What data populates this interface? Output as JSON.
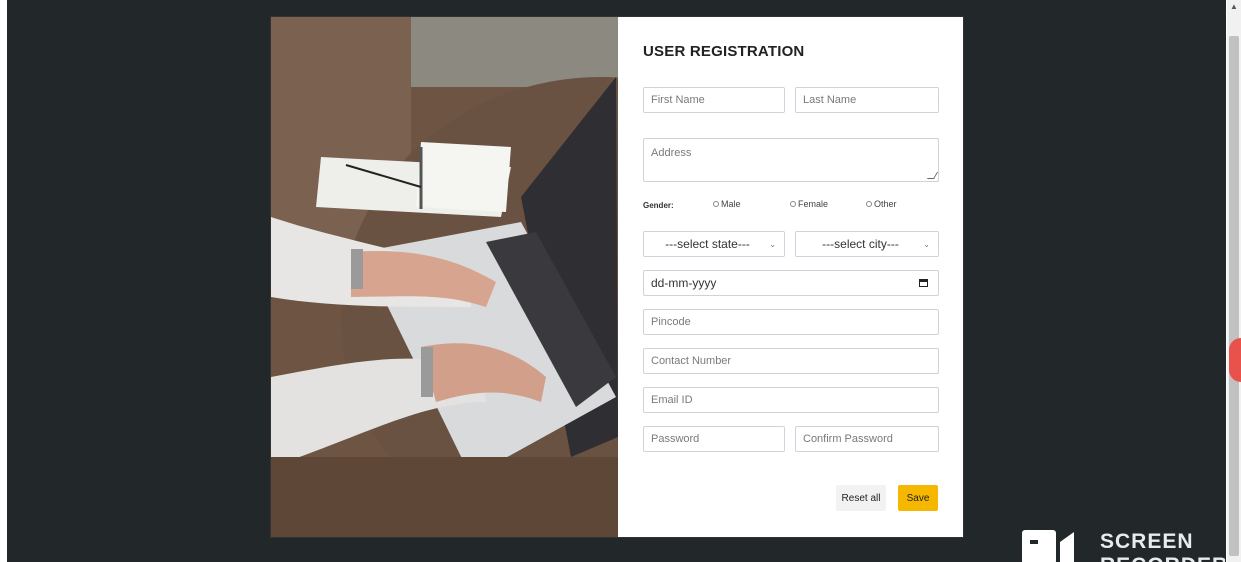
{
  "form": {
    "title": "USER REGISTRATION",
    "first_name_placeholder": "First Name",
    "last_name_placeholder": "Last Name",
    "address_placeholder": "Address",
    "gender_label": "Gender:",
    "gender_options": [
      "Male",
      "Female",
      "Other"
    ],
    "state_select": "---select state---",
    "city_select": "---select city---",
    "date_placeholder": "dd-mm-yyyy",
    "pincode_placeholder": "Pincode",
    "contact_placeholder": "Contact Number",
    "email_placeholder": "Email ID",
    "password_placeholder": "Password",
    "confirm_password_placeholder": "Confirm Password",
    "reset_label": "Reset all",
    "save_label": "Save"
  },
  "watermark": {
    "line1": "SCREEN",
    "line2": "RECORDER"
  },
  "colors": {
    "page_background": "#22272a",
    "save_button": "#f5b700",
    "reset_button": "#f2f2f2",
    "recorder_bubble": "#e8524a"
  },
  "icons": [
    "calendar-icon",
    "chevron-down-icon",
    "radio-icon",
    "camera-icon"
  ]
}
